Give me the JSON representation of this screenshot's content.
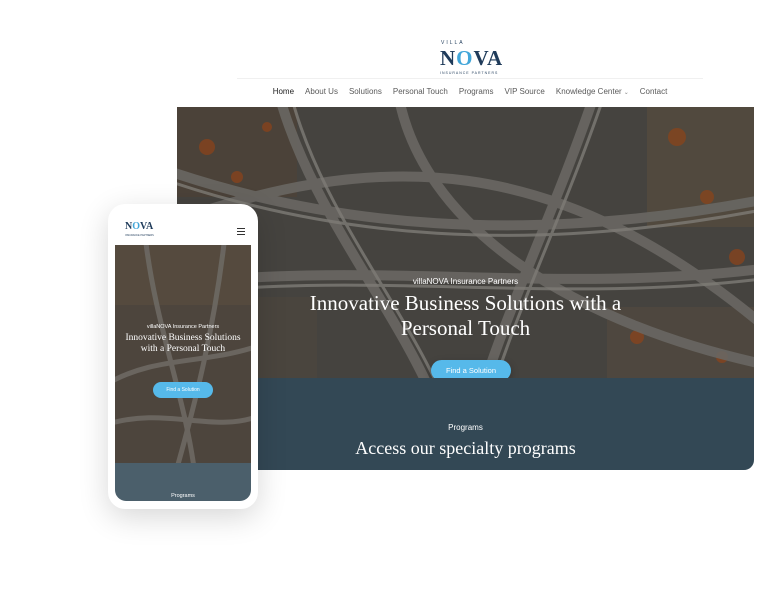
{
  "desktop": {
    "logo": {
      "top": "VILLA",
      "name_a": "N",
      "name_b": "O",
      "name_c": "VA",
      "tagline": "INSURANCE PARTNERS"
    },
    "nav": [
      {
        "label": "Home"
      },
      {
        "label": "About Us"
      },
      {
        "label": "Solutions"
      },
      {
        "label": "Personal Touch"
      },
      {
        "label": "Programs"
      },
      {
        "label": "VIP Source"
      },
      {
        "label": "Knowledge Center"
      },
      {
        "label": "Contact"
      }
    ],
    "hero": {
      "eyebrow": "villaNOVA Insurance Partners",
      "title": "Innovative Business Solutions with a Personal Touch",
      "cta": "Find a Solution"
    },
    "programs": {
      "label": "Programs",
      "title": "Access our specialty programs"
    }
  },
  "mobile": {
    "logo": {
      "name_a": "N",
      "name_b": "O",
      "name_c": "VA",
      "tagline": "INSURANCE PARTNERS"
    },
    "hero": {
      "eyebrow": "villaNOVA Insurance Partners",
      "title": "Innovative Business Solutions with a Personal Touch",
      "cta": "Find a Solution"
    },
    "programs": {
      "label": "Programs"
    }
  },
  "colors": {
    "navy": "#1f3b5a",
    "accent_blue": "#56b9ea",
    "programs_band": "#334855"
  },
  "icons": [
    "compass-star-icon",
    "hamburger-menu-icon",
    "chevron-down-icon"
  ]
}
